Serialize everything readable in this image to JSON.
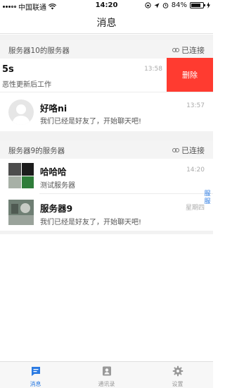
{
  "status_bar": {
    "carrier": "中国联通",
    "time": "14:20",
    "battery": "84%",
    "battery_fraction": 0.84
  },
  "nav": {
    "title": "消息"
  },
  "groups": [
    {
      "title": "服务器10的服务器",
      "status": "已连接",
      "rows": [
        {
          "name": "5s",
          "message": "恶性更新后工作",
          "time": "13:58"
        },
        {
          "name": "好咯ni",
          "message": "我们已经是好友了，开始聊天吧!",
          "time": "13:57"
        }
      ]
    },
    {
      "title": "服务器9的服务器",
      "status": "已连接",
      "rows": [
        {
          "name": "哈哈哈",
          "message": "测试服务器",
          "time": "14:20"
        },
        {
          "name": "服务器9",
          "message": "我们已经是好友了，开始聊天吧!",
          "time": "星期四"
        }
      ]
    }
  ],
  "swipe_action": {
    "label": "删除"
  },
  "side_tag": "服服",
  "tabs": [
    {
      "label": "消息",
      "icon": "message-icon",
      "active": true
    },
    {
      "label": "通讯录",
      "icon": "contacts-icon",
      "active": false
    },
    {
      "label": "设置",
      "icon": "gear-icon",
      "active": false
    }
  ],
  "colors": {
    "accent": "#2a7ae2",
    "delete": "#ff3b30"
  }
}
